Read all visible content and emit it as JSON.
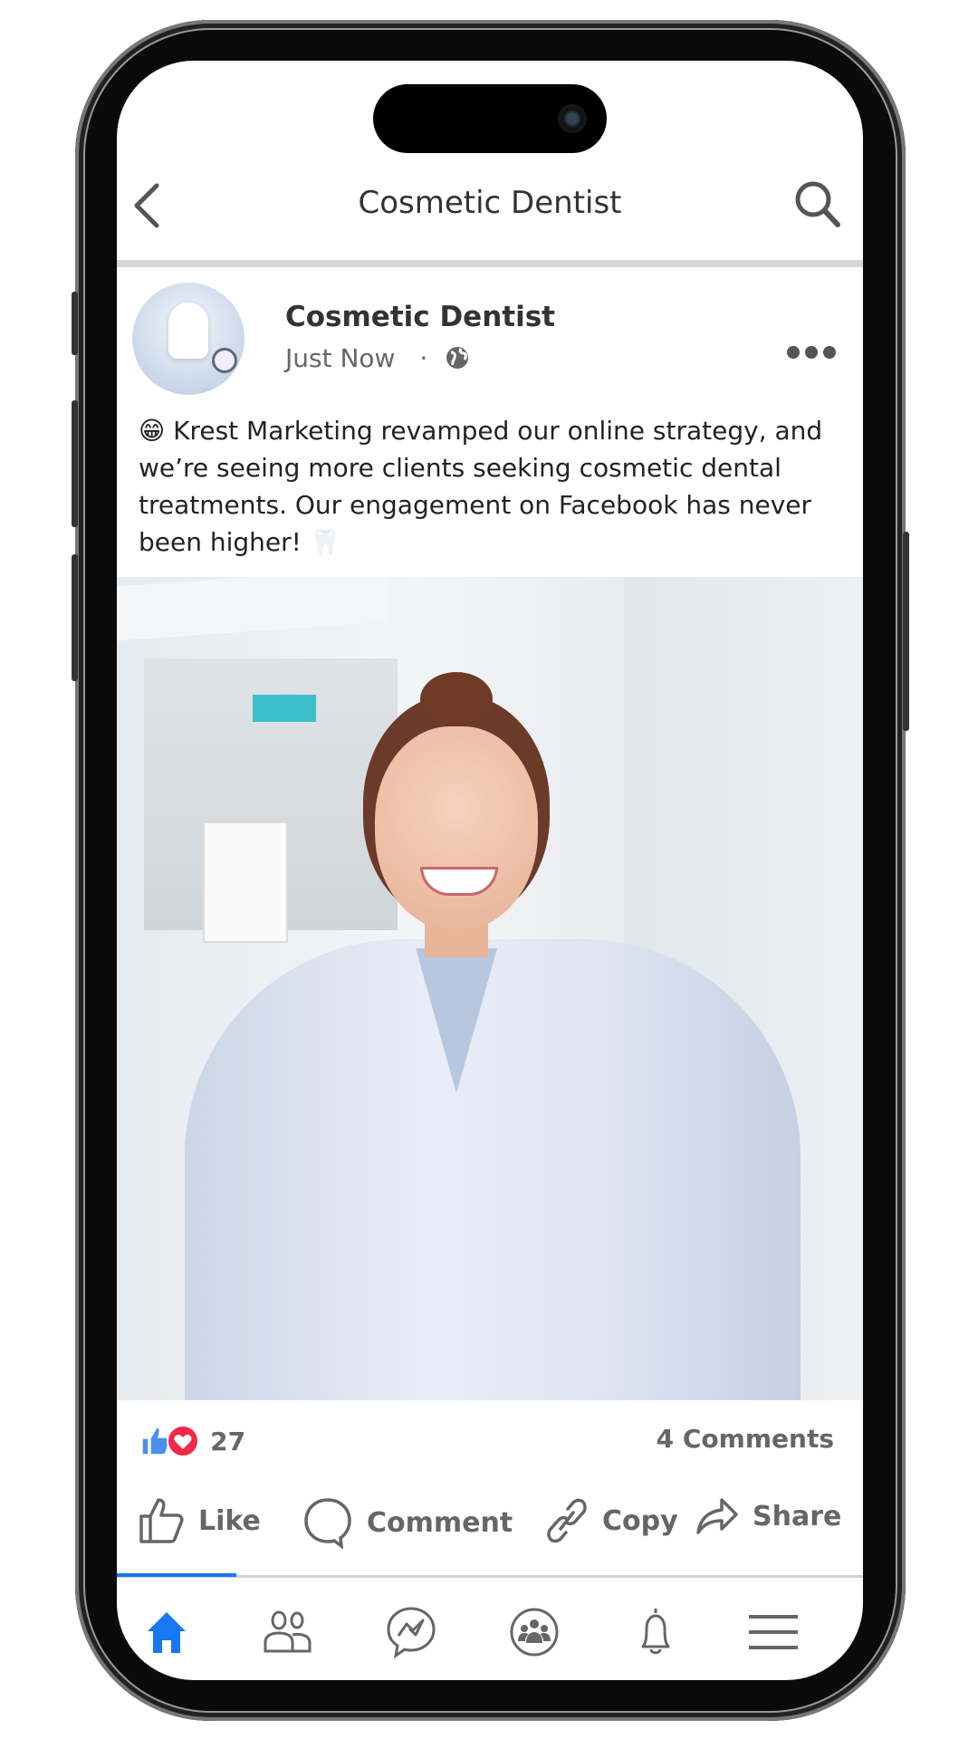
{
  "header": {
    "title": "Cosmetic Dentist",
    "back_icon": "chevron-left-icon",
    "search_icon": "search-icon"
  },
  "post": {
    "author": "Cosmetic Dentist",
    "time": "Just Now",
    "separator": "·",
    "privacy_icon": "globe-icon",
    "text_emoji": "😁",
    "text": "Krest Marketing revamped our online strategy, and we’re seeing more clients seeking cosmetic dental treatments. Our engagement on Facebook has never been higher!",
    "text_end_emoji": "🦷",
    "reactions_count": "27",
    "comments": "4 Comments"
  },
  "actions": {
    "like": "Like",
    "comment": "Comment",
    "copy": "Copy",
    "share": "Share"
  },
  "nav": {
    "items": [
      "home-icon",
      "friends-icon",
      "messenger-icon",
      "groups-icon",
      "bell-icon",
      "menu-icon"
    ],
    "active": "home-icon"
  },
  "colors": {
    "accent": "#1877f2",
    "love": "#f02849",
    "text": "#333333"
  }
}
